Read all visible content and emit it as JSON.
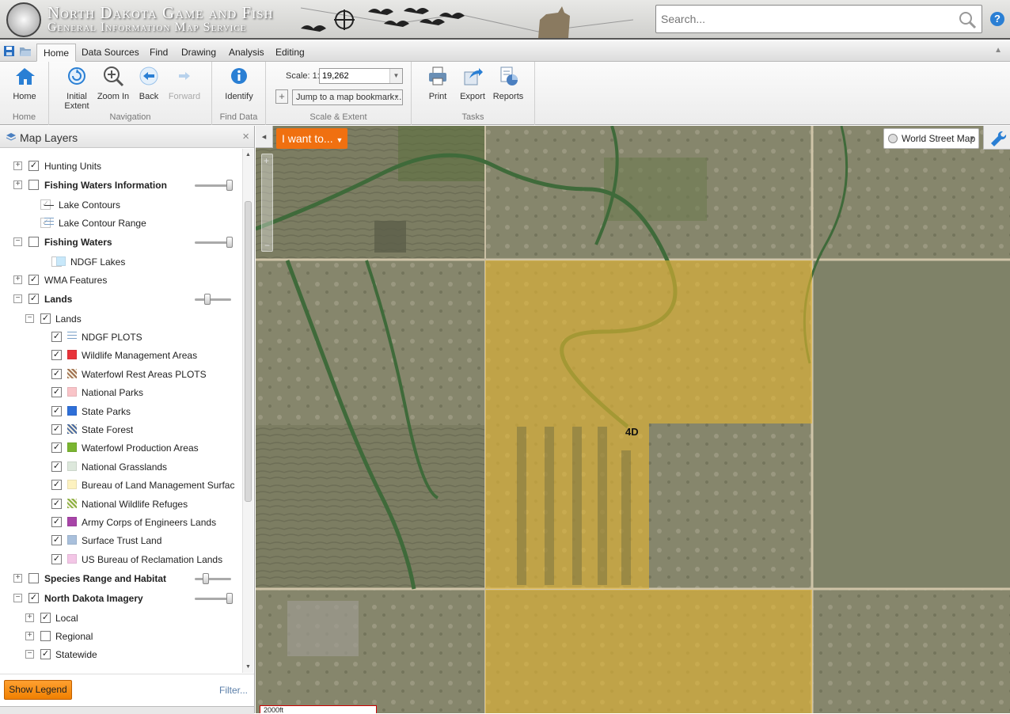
{
  "header": {
    "title_line1": "North Dakota Game and Fish",
    "title_line2": "General Information Map Service",
    "search_placeholder": "Search...",
    "help_label": "?"
  },
  "tabs": [
    "Home",
    "Data Sources",
    "Find",
    "Drawing",
    "Analysis",
    "Editing"
  ],
  "active_tab": "Home",
  "ribbon": {
    "groups": {
      "home": "Home",
      "navigation": "Navigation",
      "find_data": "Find Data",
      "scale_extent": "Scale & Extent",
      "tasks": "Tasks"
    },
    "buttons": {
      "home": "Home",
      "initial_extent_1": "Initial",
      "initial_extent_2": "Extent",
      "zoom_in": "Zoom In",
      "back": "Back",
      "forward": "Forward",
      "identify": "Identify",
      "print": "Print",
      "export": "Export",
      "reports": "Reports"
    },
    "scale_label": "Scale: 1:",
    "scale_value": "19,262",
    "bookmark_plus": "+",
    "bookmark_text": "Jump to a map bookmark..."
  },
  "panel": {
    "title": "Map Layers",
    "close": "×",
    "show_legend": "Show Legend",
    "filter": "Filter..."
  },
  "layers": [
    {
      "label": "Hunting Units",
      "checked": true,
      "expand": "+",
      "bold": false,
      "level": 0
    },
    {
      "label": "Fishing Waters Information",
      "checked": false,
      "expand": "+",
      "bold": true,
      "level": 0,
      "slider": 0.95
    },
    {
      "label": "Lake Contours",
      "checked": true,
      "dim": true,
      "level": 1,
      "swatch": "line"
    },
    {
      "label": "Lake Contour Range",
      "checked": true,
      "dim": true,
      "level": 1,
      "swatch": "list"
    },
    {
      "label": "Fishing Waters",
      "checked": false,
      "expand": "−",
      "bold": true,
      "level": 0,
      "slider": 0.95
    },
    {
      "label": "NDGF Lakes",
      "checked": false,
      "dim": true,
      "level": 2,
      "swatch": "#c8e8fa"
    },
    {
      "label": "WMA Features",
      "checked": true,
      "expand": "+",
      "bold": false,
      "level": 0
    },
    {
      "label": "Lands",
      "checked": true,
      "expand": "−",
      "bold": true,
      "level": 0,
      "slider": 0.35
    },
    {
      "label": "Lands",
      "checked": true,
      "expand": "−",
      "bold": false,
      "level": 1
    },
    {
      "label": "NDGF PLOTS",
      "checked": true,
      "level": 2,
      "swatch": "list"
    },
    {
      "label": "Wildlife Management Areas",
      "checked": true,
      "level": 2,
      "swatch": "#e8333a"
    },
    {
      "label": "Waterfowl Rest Areas PLOTS",
      "checked": true,
      "level": 2,
      "swatch": "hatch-brown"
    },
    {
      "label": "National Parks",
      "checked": true,
      "level": 2,
      "swatch": "#f9c4c8"
    },
    {
      "label": "State Parks",
      "checked": true,
      "level": 2,
      "swatch": "#2e6fd8"
    },
    {
      "label": "State Forest",
      "checked": true,
      "level": 2,
      "swatch": "hatch-blue"
    },
    {
      "label": "Waterfowl Production Areas",
      "checked": true,
      "level": 2,
      "swatch": "#7ab530"
    },
    {
      "label": "National Grasslands",
      "checked": true,
      "level": 2,
      "swatch": "#dde8dc"
    },
    {
      "label": "Bureau of Land Management Surface ar",
      "checked": true,
      "level": 2,
      "swatch": "#fdf2c0"
    },
    {
      "label": "National Wildlife Refuges",
      "checked": true,
      "level": 2,
      "swatch": "hatch-green"
    },
    {
      "label": "Army Corps of Engineers Lands",
      "checked": true,
      "level": 2,
      "swatch": "#a845a8"
    },
    {
      "label": "Surface Trust Land",
      "checked": true,
      "level": 2,
      "swatch": "#a9c0dc"
    },
    {
      "label": "US Bureau of Reclamation Lands",
      "checked": true,
      "level": 2,
      "swatch": "#f3c6e6"
    },
    {
      "label": "Species Range and Habitat",
      "checked": false,
      "expand": "+",
      "bold": true,
      "level": 0,
      "slider": 0.3
    },
    {
      "label": "North Dakota Imagery",
      "checked": true,
      "expand": "−",
      "bold": true,
      "level": 0,
      "slider": 0.95
    },
    {
      "label": "Local",
      "checked": true,
      "expand": "+",
      "bold": false,
      "level": 1
    },
    {
      "label": "Regional",
      "checked": false,
      "expand": "+",
      "bold": false,
      "level": 1
    },
    {
      "label": "Statewide",
      "checked": true,
      "expand": "−",
      "bold": false,
      "level": 1
    }
  ],
  "map": {
    "collapse": "◂",
    "i_want_to": "I want to...",
    "basemap": "World Street Map",
    "feature_label": "4D",
    "scalebar": "2000ft"
  },
  "colors": {
    "accent_orange": "#f07010",
    "ribbon_icon_blue": "#2a7fd4",
    "selected_land_overlay": "#e8b830"
  }
}
